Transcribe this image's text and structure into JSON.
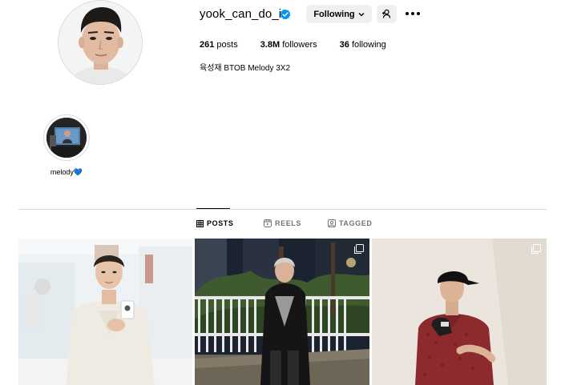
{
  "profile": {
    "username": "yook_can_do_it",
    "verified": true,
    "following_button_label": "Following",
    "stats": {
      "posts_count": "261",
      "posts_label": "posts",
      "followers_count": "3.8M",
      "followers_label": "followers",
      "following_count": "36",
      "following_label": "following"
    },
    "bio": "육성재 BTOB Melody 3X2"
  },
  "highlights": [
    {
      "label": "melody💙"
    }
  ],
  "tabs": [
    {
      "label": "POSTS",
      "active": true,
      "icon": "grid-icon"
    },
    {
      "label": "REELS",
      "active": false,
      "icon": "reels-icon"
    },
    {
      "label": "TAGGED",
      "active": false,
      "icon": "tagged-icon"
    }
  ],
  "posts": [
    {
      "multi": false,
      "scene": "white-suit-studio"
    },
    {
      "multi": true,
      "scene": "night-street-leather-jacket"
    },
    {
      "multi": true,
      "scene": "wall-cap-golf-polo"
    }
  ],
  "colors": {
    "verified_blue": "#0095f6",
    "button_bg": "#efefef",
    "divider": "#dbdbdb",
    "muted_text": "#737373"
  }
}
